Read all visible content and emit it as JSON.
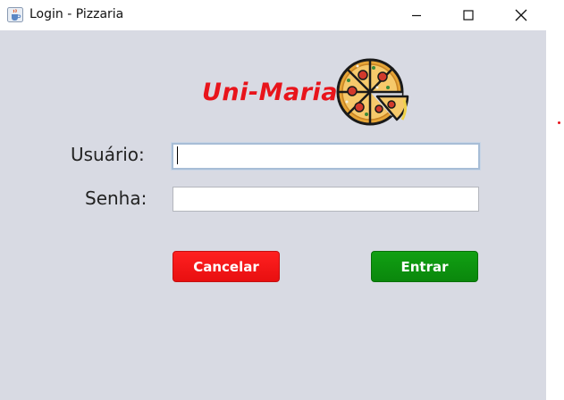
{
  "window": {
    "title": "Login - Pizzaria",
    "icon": "java-cup-icon",
    "controls": [
      "minimize-icon",
      "maximize-icon",
      "close-icon"
    ]
  },
  "brand": {
    "name": "Uni-Maria",
    "color": "#e8141b",
    "logo": "pizza-icon"
  },
  "form": {
    "user_label": "Usuário:",
    "user_value": "",
    "password_label": "Senha:",
    "password_value": ""
  },
  "buttons": {
    "cancel_label": "Cancelar",
    "cancel_color": "#f21516",
    "enter_label": "Entrar",
    "enter_color": "#0e960f"
  }
}
